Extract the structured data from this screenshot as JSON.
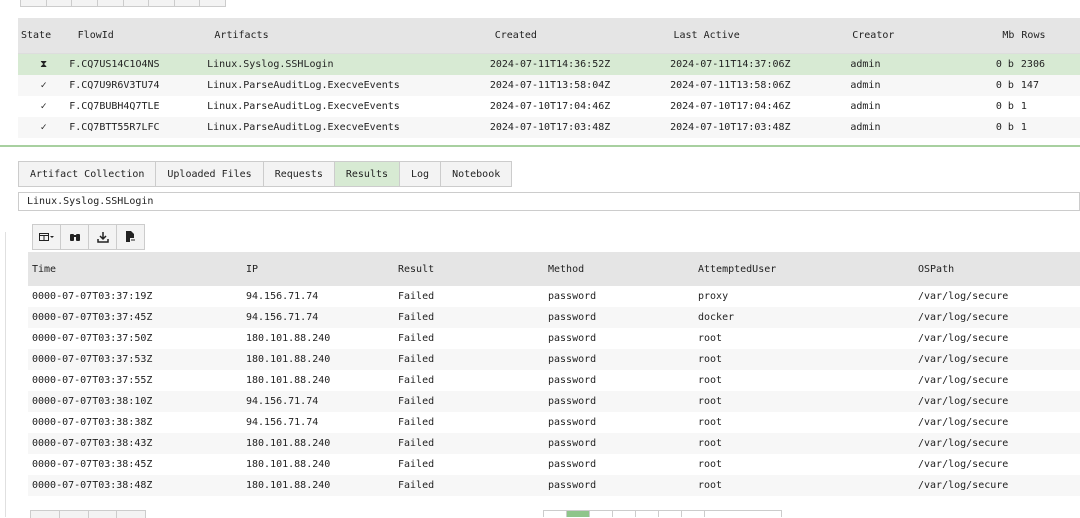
{
  "flows": {
    "headers": [
      "State",
      "FlowId",
      "Artifacts",
      "Created",
      "Last Active",
      "Creator",
      "Mb",
      "Rows"
    ],
    "rows": [
      {
        "state": "⧗",
        "flow_id": "F.CQ7US14C1O4NS",
        "artifact": "Linux.Syslog.SSHLogin",
        "created": "2024-07-11T14:36:52Z",
        "last_active": "2024-07-11T14:37:06Z",
        "creator": "admin",
        "mb": "0 b",
        "rows": "2306",
        "selected": true
      },
      {
        "state": "✓",
        "flow_id": "F.CQ7U9R6V3TU74",
        "artifact": "Linux.ParseAuditLog.ExecveEvents",
        "created": "2024-07-11T13:58:04Z",
        "last_active": "2024-07-11T13:58:06Z",
        "creator": "admin",
        "mb": "0 b",
        "rows": "147",
        "selected": false
      },
      {
        "state": "✓",
        "flow_id": "F.CQ7BUBH4Q7TLE",
        "artifact": "Linux.ParseAuditLog.ExecveEvents",
        "created": "2024-07-10T17:04:46Z",
        "last_active": "2024-07-10T17:04:46Z",
        "creator": "admin",
        "mb": "0 b",
        "rows": "1",
        "selected": false
      },
      {
        "state": "✓",
        "flow_id": "F.CQ7BTT55R7LFC",
        "artifact": "Linux.ParseAuditLog.ExecveEvents",
        "created": "2024-07-10T17:03:48Z",
        "last_active": "2024-07-10T17:03:48Z",
        "creator": "admin",
        "mb": "0 b",
        "rows": "1",
        "selected": false
      }
    ]
  },
  "tabs": [
    {
      "label": "Artifact Collection",
      "active": false
    },
    {
      "label": "Uploaded Files",
      "active": false
    },
    {
      "label": "Requests",
      "active": false
    },
    {
      "label": "Results",
      "active": true
    },
    {
      "label": "Log",
      "active": false
    },
    {
      "label": "Notebook",
      "active": false
    }
  ],
  "artifact_selector": {
    "value": "Linux.Syslog.SSHLogin"
  },
  "toolbar": {
    "icons": [
      "columns-dropdown-icon",
      "binoculars-icon",
      "download-icon",
      "export-file-icon"
    ]
  },
  "results": {
    "headers": [
      "Time",
      "IP",
      "Result",
      "Method",
      "AttemptedUser",
      "OSPath"
    ],
    "rows": [
      [
        "0000-07-07T03:37:19Z",
        "94.156.71.74",
        "Failed",
        "password",
        "proxy",
        "/var/log/secure"
      ],
      [
        "0000-07-07T03:37:45Z",
        "94.156.71.74",
        "Failed",
        "password",
        "docker",
        "/var/log/secure"
      ],
      [
        "0000-07-07T03:37:50Z",
        "180.101.88.240",
        "Failed",
        "password",
        "root",
        "/var/log/secure"
      ],
      [
        "0000-07-07T03:37:53Z",
        "180.101.88.240",
        "Failed",
        "password",
        "root",
        "/var/log/secure"
      ],
      [
        "0000-07-07T03:37:55Z",
        "180.101.88.240",
        "Failed",
        "password",
        "root",
        "/var/log/secure"
      ],
      [
        "0000-07-07T03:38:10Z",
        "94.156.71.74",
        "Failed",
        "password",
        "root",
        "/var/log/secure"
      ],
      [
        "0000-07-07T03:38:38Z",
        "94.156.71.74",
        "Failed",
        "password",
        "root",
        "/var/log/secure"
      ],
      [
        "0000-07-07T03:38:43Z",
        "180.101.88.240",
        "Failed",
        "password",
        "root",
        "/var/log/secure"
      ],
      [
        "0000-07-07T03:38:45Z",
        "180.101.88.240",
        "Failed",
        "password",
        "root",
        "/var/log/secure"
      ],
      [
        "0000-07-07T03:38:48Z",
        "180.101.88.240",
        "Failed",
        "password",
        "root",
        "/var/log/secure"
      ]
    ]
  },
  "colors": {
    "selected_row": "#d7ead3",
    "active_tab": "#d7ead3",
    "header_bg": "#e5e5e5",
    "pager_current": "#8fc58a"
  }
}
